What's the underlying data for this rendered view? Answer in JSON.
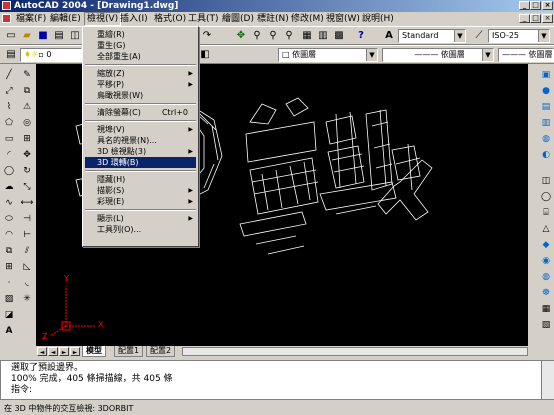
{
  "window": {
    "title": "AutoCAD 2004 - [Drawing1.dwg]"
  },
  "menubar": {
    "items": [
      "檔案(F)",
      "編輯(E)",
      "檢視(V)",
      "插入(I)",
      "格式(O)",
      "工具(T)",
      "繪圖(D)",
      "標註(N)",
      "修改(M)",
      "視窗(W)",
      "說明(H)"
    ]
  },
  "toolbar": {
    "textstyle": "Standard",
    "dimstyle": "ISO-25",
    "layer": "0",
    "linetype1": "依圖層",
    "linetype2": "依圖層",
    "linetype3": "依圖層",
    "color": "依圖層"
  },
  "view_menu": {
    "items": [
      {
        "label": "重繪(R)"
      },
      {
        "label": "重生(G)"
      },
      {
        "label": "全部重生(A)"
      },
      {
        "sep": true
      },
      {
        "label": "縮放(Z)",
        "submenu": true
      },
      {
        "label": "平移(P)",
        "submenu": true
      },
      {
        "label": "鳥瞰視景(W)"
      },
      {
        "sep": true
      },
      {
        "label": "清除螢幕(C)",
        "shortcut": "Ctrl+0"
      },
      {
        "sep": true
      },
      {
        "label": "視埠(V)",
        "submenu": true
      },
      {
        "label": "具名的視景(N)..."
      },
      {
        "label": "3D 檢視點(3)",
        "submenu": true
      },
      {
        "label": "3D 環轉(B)",
        "selected": true
      },
      {
        "sep": true
      },
      {
        "label": "隱藏(H)"
      },
      {
        "label": "描影(S)",
        "submenu": true
      },
      {
        "label": "彩現(E)",
        "submenu": true
      },
      {
        "sep": true
      },
      {
        "label": "顯示(L)",
        "submenu": true
      },
      {
        "label": "工具列(O)..."
      }
    ]
  },
  "tabs": [
    "模型",
    "配置1",
    "配置2"
  ],
  "ucs": {
    "x": "X",
    "y": "Y",
    "z": "Z"
  },
  "command": {
    "lines": [
      "選取了預設邊界。",
      "100% 完成，405 條掃描線，共 405 條",
      "指令:"
    ]
  },
  "status": {
    "text": "在 3D 中物件的交互檢視: 3DORBIT"
  },
  "colors": {
    "title_start": "#0a246a",
    "title_end": "#a6caf0",
    "menu_highlight": "#0a246a",
    "canvas": "#000000"
  }
}
